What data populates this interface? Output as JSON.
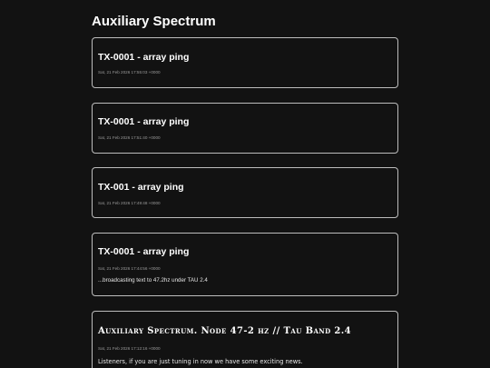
{
  "page": {
    "title": "Auxiliary Spectrum"
  },
  "posts": [
    {
      "title": "TX-0001 - array ping",
      "date": "Sat, 21 Feb 2026 17:55:03 +0000",
      "body": ""
    },
    {
      "title": "TX-0001 - array ping",
      "date": "Sat, 21 Feb 2026 17:51:40 +0000",
      "body": ""
    },
    {
      "title": "TX-001 - array ping",
      "date": "Sat, 21 Feb 2026 17:49:48 +0000",
      "body": ""
    },
    {
      "title": "TX-0001 - array ping",
      "date": "Sat, 21 Feb 2026 17:44:56 +0000",
      "body": "...broadcasting text to 47.2hz under TAU 2.4"
    },
    {
      "title": "Auxiliary Spectrum. Node 47-2 hz // Tau Band 2.4",
      "date": "Sat, 21 Feb 2026 17:12:16 +0000",
      "body": "Listeners, if you are just tuning in now we have some exciting news."
    }
  ]
}
